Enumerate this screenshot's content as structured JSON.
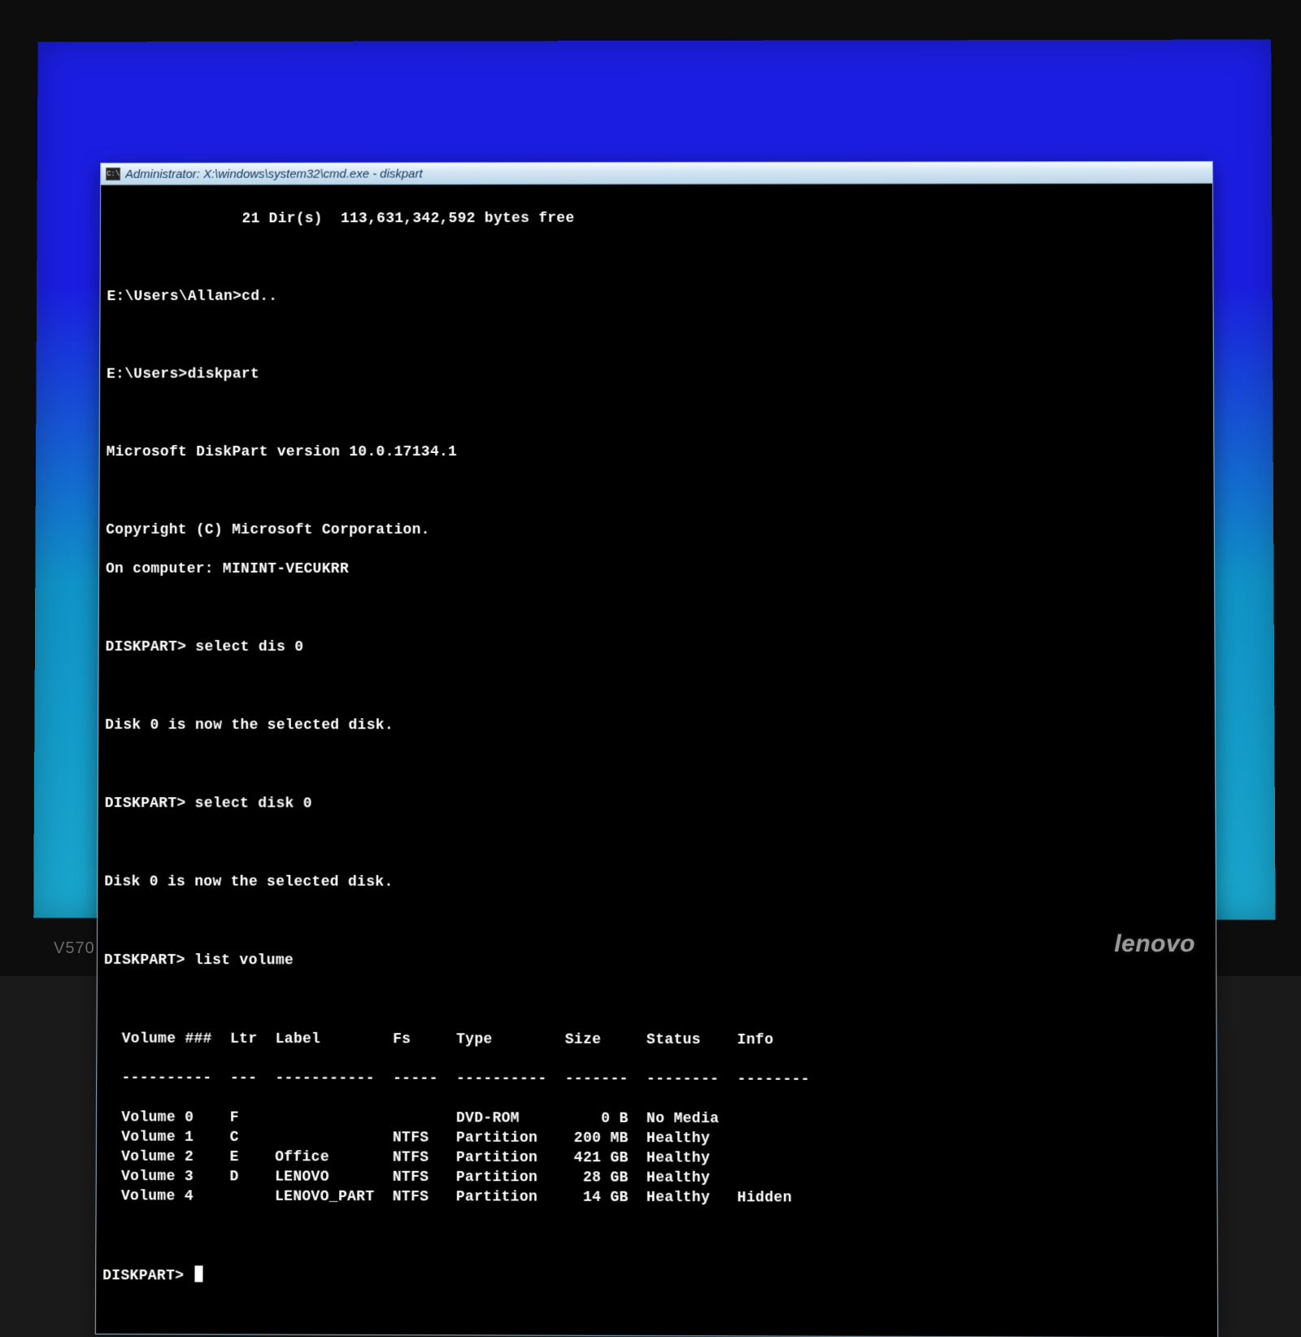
{
  "device": {
    "brand": "lenovo",
    "model": "V570"
  },
  "window": {
    "title": "Administrator: X:\\windows\\system32\\cmd.exe - diskpart",
    "icon_label": "C:\\"
  },
  "terminal": {
    "top_free_line": "               21 Dir(s)  113,631,342,592 bytes free",
    "prompt1": "E:\\Users\\Allan>",
    "cmd1": "cd..",
    "prompt2": "E:\\Users>",
    "cmd2": "diskpart",
    "dp_version": "Microsoft DiskPart version 10.0.17134.1",
    "copyright": "Copyright (C) Microsoft Corporation.",
    "on_computer": "On computer: MININT-VECUKRR",
    "dp_prompt": "DISKPART>",
    "sel1": "select dis 0",
    "sel1_resp": "Disk 0 is now the selected disk.",
    "sel2": "select disk 0",
    "sel2_resp": "Disk 0 is now the selected disk.",
    "listcmd": "list volume",
    "table": {
      "headers": {
        "vol": "Volume ###",
        "ltr": "Ltr",
        "label": "Label",
        "fs": "Fs",
        "type": "Type",
        "size": "Size",
        "status": "Status",
        "info": "Info"
      },
      "rows": [
        {
          "vol": "Volume 0",
          "ltr": "F",
          "label": "",
          "fs": "",
          "type": "DVD-ROM",
          "size": "0 B",
          "status": "No Media",
          "info": ""
        },
        {
          "vol": "Volume 1",
          "ltr": "C",
          "label": "",
          "fs": "NTFS",
          "type": "Partition",
          "size": "200 MB",
          "status": "Healthy",
          "info": ""
        },
        {
          "vol": "Volume 2",
          "ltr": "E",
          "label": "Office",
          "fs": "NTFS",
          "type": "Partition",
          "size": "421 GB",
          "status": "Healthy",
          "info": ""
        },
        {
          "vol": "Volume 3",
          "ltr": "D",
          "label": "LENOVO",
          "fs": "NTFS",
          "type": "Partition",
          "size": "28 GB",
          "status": "Healthy",
          "info": ""
        },
        {
          "vol": "Volume 4",
          "ltr": "",
          "label": "LENOVO_PART",
          "fs": "NTFS",
          "type": "Partition",
          "size": "14 GB",
          "status": "Healthy",
          "info": "Hidden"
        }
      ]
    },
    "final_prompt": "DISKPART>"
  },
  "col_widths": {
    "indent": 2,
    "vol": 12,
    "ltr": 5,
    "label": 13,
    "fs": 7,
    "type": 12,
    "size": 9,
    "status": 10,
    "info": 8
  }
}
